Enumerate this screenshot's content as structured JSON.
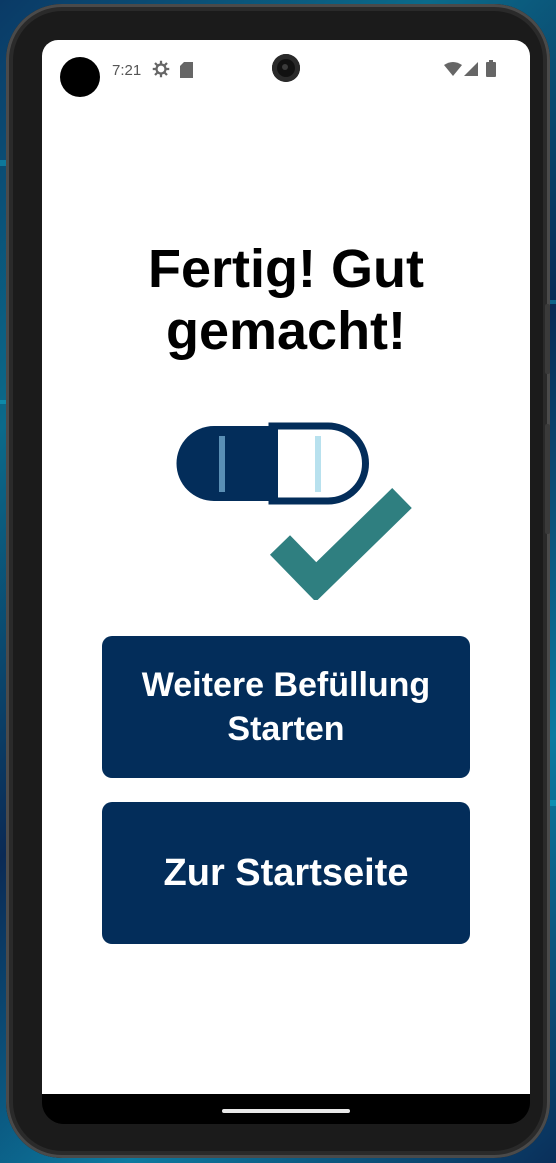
{
  "status_bar": {
    "time": "7:21",
    "icons": [
      "settings-gear-icon",
      "sd-card-icon",
      "wifi-icon",
      "cell-signal-icon",
      "battery-icon"
    ]
  },
  "screen": {
    "title": "Fertig! Gut gemacht!",
    "illustration": "pill-capsule-with-checkmark",
    "colors": {
      "primary": "#032d5a",
      "check": "#2f7f80",
      "capsule_stripe_light": "#b8e1ee",
      "capsule_stripe_dark": "#5a8fb5"
    }
  },
  "buttons": {
    "more_filling": "Weitere Befüllung\nStarten",
    "home": "Zur Startseite"
  }
}
